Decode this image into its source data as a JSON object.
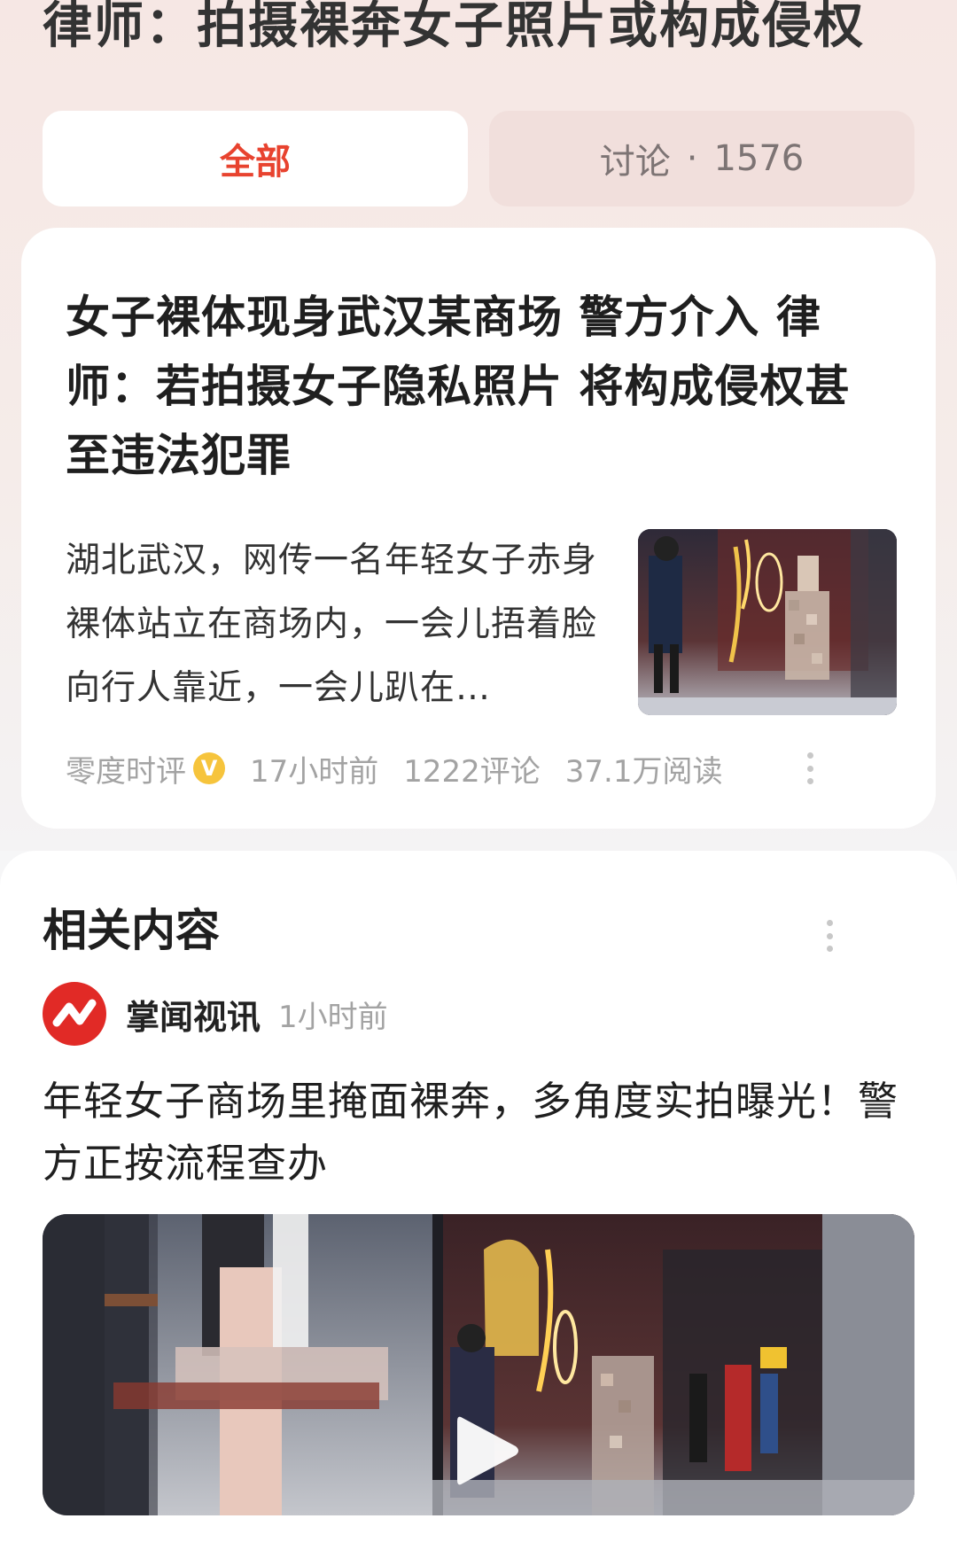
{
  "page": {
    "title": "律师：拍摄裸奔女子照片或构成侵权"
  },
  "tabs": [
    {
      "label": "全部"
    },
    {
      "label": "讨论",
      "separator": "·",
      "count": "1576"
    }
  ],
  "news_card": {
    "headline": "女子裸体现身武汉某商场 警方介入 律师：若拍摄女子隐私照片 将构成侵权甚至违法犯罪",
    "summary": "湖北武汉，网传一名年轻女子赤身裸体站立在商场内，一会儿捂着脸向行人靠近，一会儿趴在…",
    "source": "零度时评",
    "verified_badge": "V",
    "time": "17小时前",
    "comments": "1222评论",
    "reads": "37.1万阅读",
    "thumbnail_icon": "news-photo"
  },
  "related": {
    "title": "相关内容",
    "source_name": "掌闻视讯",
    "source_time": "1小时前",
    "headline": "年轻女子商场里掩面裸奔，多角度实拍曝光！警方正按流程查办",
    "video_icon": "play-icon"
  },
  "colors": {
    "accent": "#e8432f",
    "verified": "#f6c43c",
    "source_logo": "#e12a26",
    "meta_gray": "#a3a3a3"
  }
}
